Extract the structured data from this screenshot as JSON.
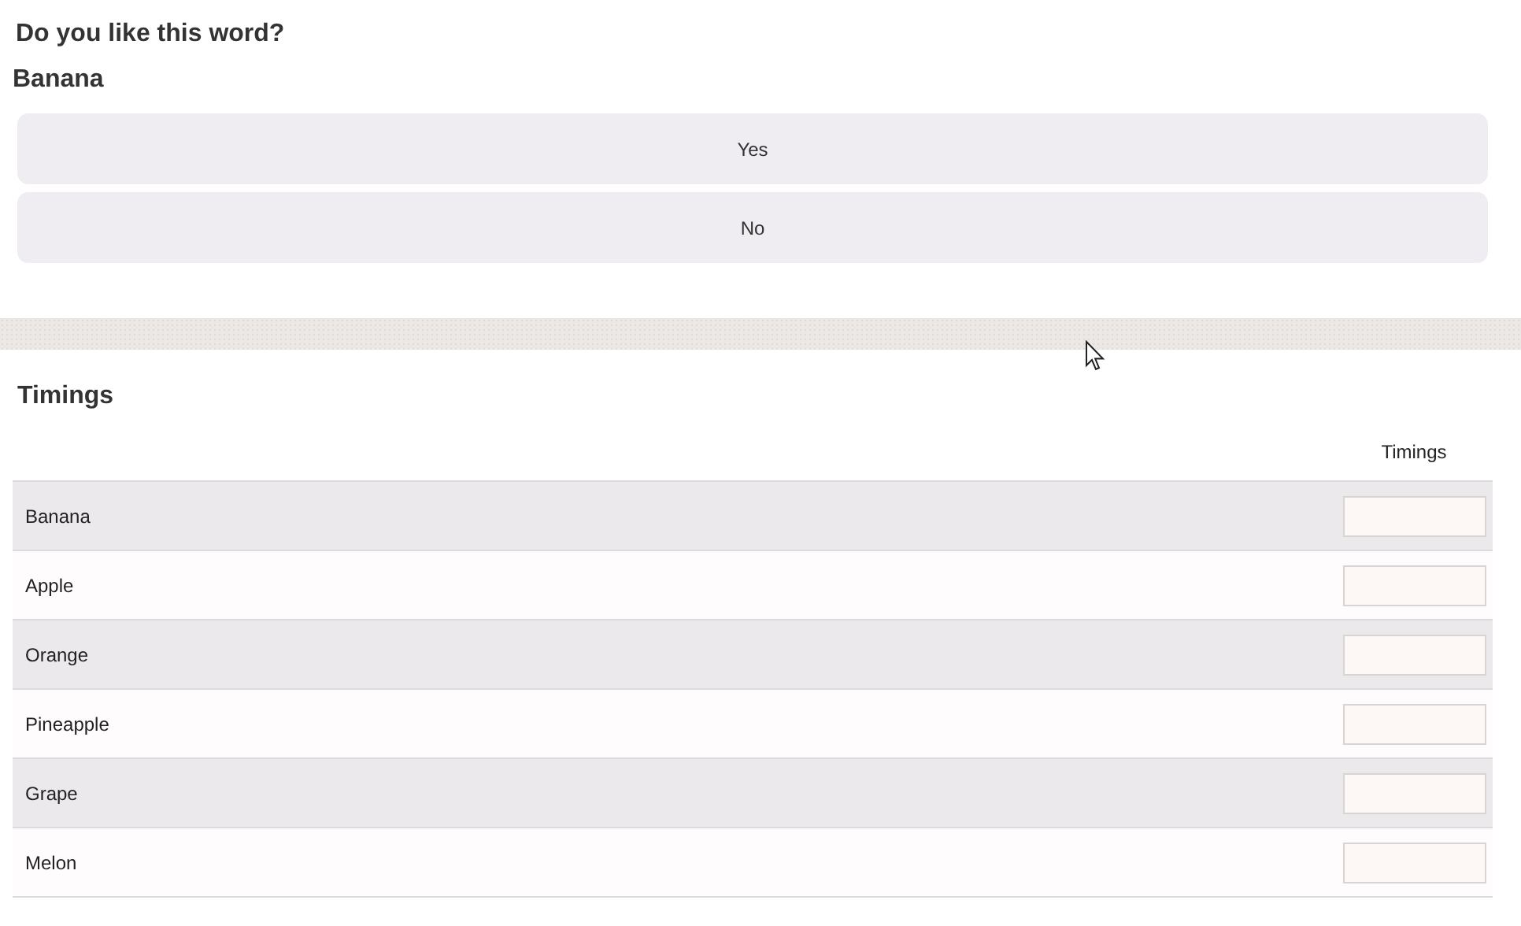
{
  "question": {
    "title": "Do you like this word?",
    "word": "Banana",
    "options": [
      "Yes",
      "No"
    ]
  },
  "timings": {
    "title": "Timings",
    "columns": [
      "Timings"
    ],
    "rows": [
      {
        "name": "Banana"
      },
      {
        "name": "Apple"
      },
      {
        "name": "Orange"
      },
      {
        "name": "Pineapple"
      },
      {
        "name": "Grape"
      },
      {
        "name": "Melon"
      }
    ]
  }
}
